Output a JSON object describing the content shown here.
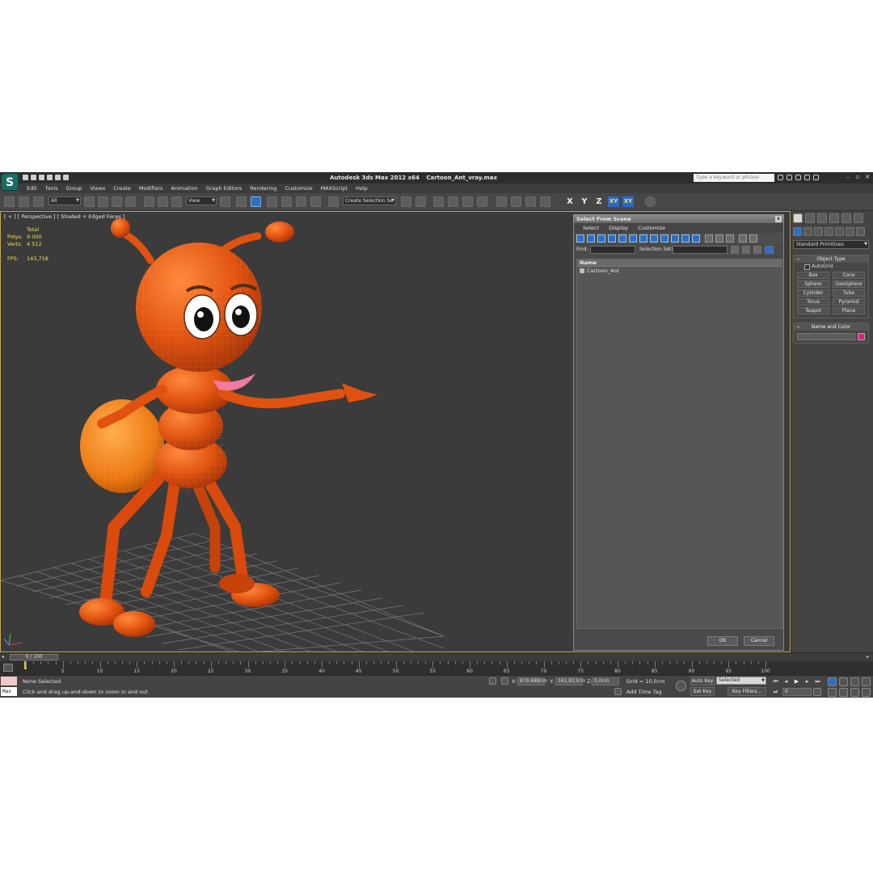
{
  "window": {
    "app_name": "Autodesk 3ds Max  2012 x64",
    "file_name": "Cartoon_Ant_vray.max",
    "search_placeholder": "Type a keyword or phrase",
    "logo_glyph": "S"
  },
  "menu": [
    "Edit",
    "Tools",
    "Group",
    "Views",
    "Create",
    "Modifiers",
    "Animation",
    "Graph Editors",
    "Rendering",
    "Customize",
    "MAXScript",
    "Help"
  ],
  "toolbar": {
    "selection_filter": "All",
    "reference_coord": "View",
    "named_selection": "Create Selection Se",
    "axis": [
      "X",
      "Y",
      "Z",
      "XY",
      "XY"
    ]
  },
  "viewport": {
    "label": "[ + ] [ Perspective ] [ Shaded + Edged Faces ]",
    "stats": {
      "total_label": "Total",
      "rows": [
        {
          "key": "Polys:",
          "value": "9 000"
        },
        {
          "key": "Verts:",
          "value": "4 512"
        }
      ],
      "fps_label": "FPS:",
      "fps_value": "143,718"
    }
  },
  "dialog": {
    "title": "Select From Scene",
    "close": "x",
    "menu": [
      "Select",
      "Display",
      "Customize"
    ],
    "find_label": "Find:",
    "selection_set_label": "Selection Set:",
    "column_header": "Name",
    "items": [
      "Cartoon_Ant"
    ],
    "ok": "OK",
    "cancel": "Cancel"
  },
  "command_panel": {
    "category": "Standard Primitives",
    "object_type_title": "Object Type",
    "autogrid": "AutoGrid",
    "primitives": [
      "Box",
      "Cone",
      "Sphere",
      "GeoSphere",
      "Cylinder",
      "Tube",
      "Torus",
      "Pyramid",
      "Teapot",
      "Plane"
    ],
    "name_color_title": "Name and Color",
    "object_color": "#e0217a"
  },
  "timeline": {
    "frame_display": "0 / 100",
    "ticks": [
      "0",
      "5",
      "10",
      "15",
      "20",
      "25",
      "30",
      "35",
      "40",
      "45",
      "50",
      "55",
      "60",
      "65",
      "70",
      "75",
      "80",
      "85",
      "90",
      "95",
      "100"
    ]
  },
  "status": {
    "maxscript_label": "Max",
    "selection": "None Selected",
    "prompt": "Click and drag up-and-down to zoom in and out",
    "x_label": "X:",
    "x_value": "879,688cm",
    "y_label": "Y:",
    "y_value": "161,813cm",
    "z_label": "Z:",
    "z_value": "0,0cm",
    "grid": "Grid = 10,0cm",
    "auto_key": "Auto Key",
    "auto_key_mode": "Selected",
    "set_key": "Set Key",
    "key_filters": "Key Filters...",
    "add_time_tag": "Add Time Tag",
    "current_frame": "0"
  },
  "colors": {
    "accent": "#2a6acb",
    "viewport_border": "#c7a84a",
    "stats_text": "#f3e05a",
    "ant_body": "#e0520f"
  }
}
